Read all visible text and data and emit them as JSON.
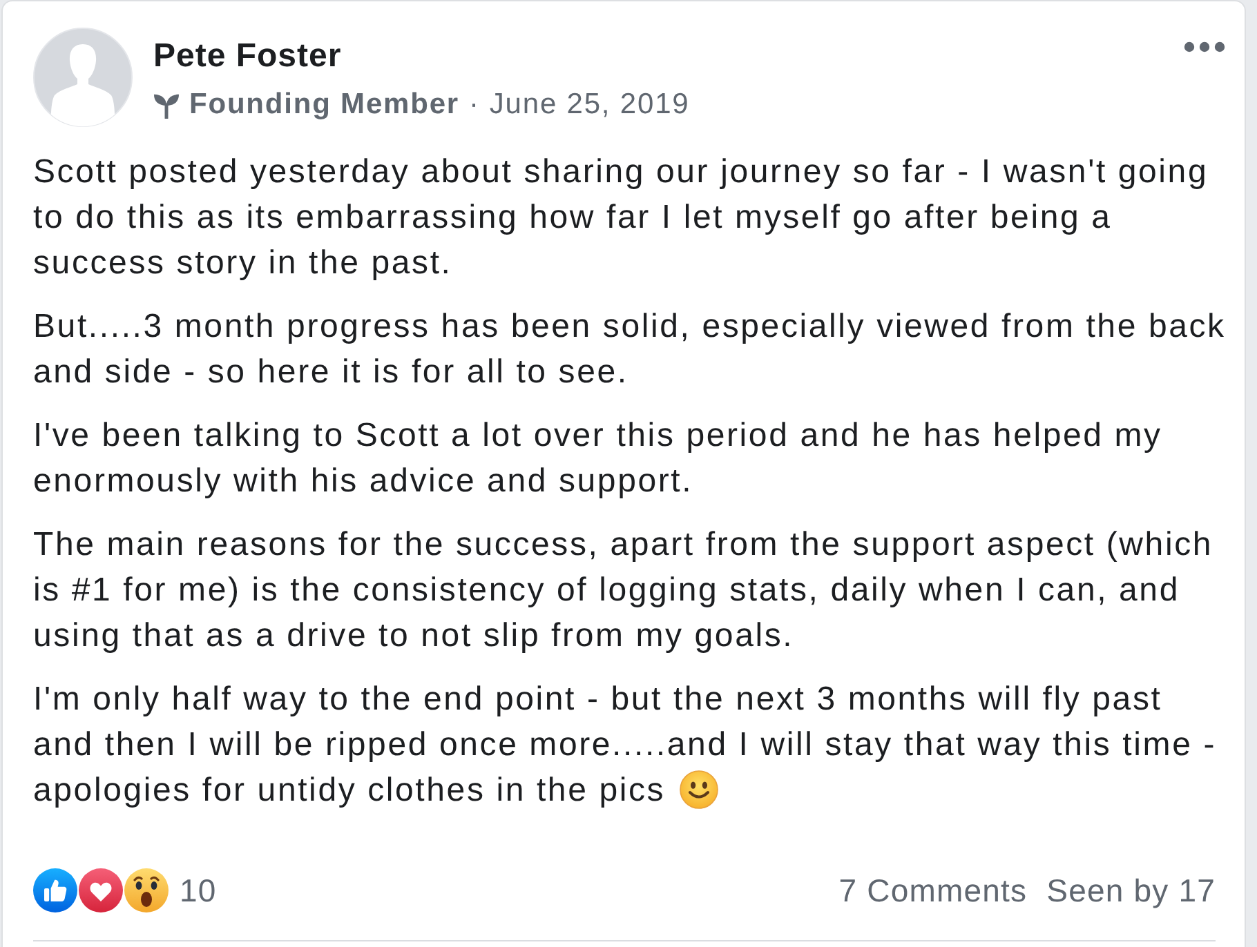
{
  "post": {
    "author": {
      "name": "Pete Foster",
      "badge": "Founding Member",
      "separator": "·",
      "date": "June 25, 2019"
    },
    "paragraphs": [
      {
        "text": "Scott posted yesterday about sharing our journey so far - I wasn't going to do this as its embarrassing how far I let myself go after being a success story in the past.",
        "ends_with_emoji": false
      },
      {
        "text": "But.....3 month progress has been solid, especially viewed from the back and side - so here it is for all to see.",
        "ends_with_emoji": false
      },
      {
        "text": "I've been talking to Scott a lot over this period and he has helped my enormously with his advice and support.",
        "ends_with_emoji": false
      },
      {
        "text": "The main reasons for the success, apart from the support aspect (which is #1 for me) is the consistency of logging stats, daily when I can, and using that as a drive to not slip from my goals.",
        "ends_with_emoji": false
      },
      {
        "text": "I'm only half way to the end point - but the next 3 months will fly past and then I will be ripped once more.....and I will stay that way this time - apologies for untidy clothes in the pics",
        "ends_with_emoji": true
      }
    ],
    "footer": {
      "reactions": [
        {
          "kind": "like"
        },
        {
          "kind": "love"
        },
        {
          "kind": "wow"
        }
      ],
      "reaction_count": "10",
      "comments": "7 Comments",
      "seen_by": "Seen by 17"
    }
  }
}
